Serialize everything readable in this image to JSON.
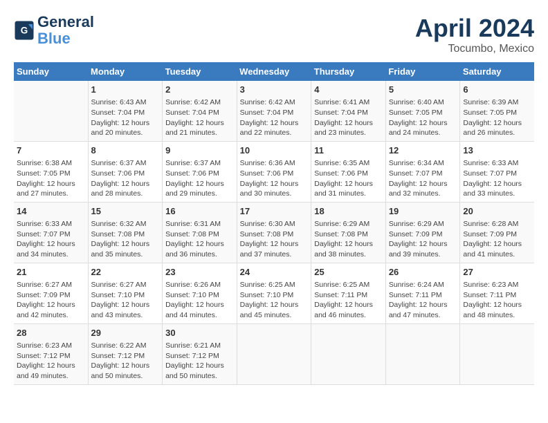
{
  "header": {
    "logo_line1": "General",
    "logo_line2": "Blue",
    "title": "April 2024",
    "subtitle": "Tocumbo, Mexico"
  },
  "days_of_week": [
    "Sunday",
    "Monday",
    "Tuesday",
    "Wednesday",
    "Thursday",
    "Friday",
    "Saturday"
  ],
  "weeks": [
    [
      {
        "day": "",
        "info": ""
      },
      {
        "day": "1",
        "info": "Sunrise: 6:43 AM\nSunset: 7:04 PM\nDaylight: 12 hours\nand 20 minutes."
      },
      {
        "day": "2",
        "info": "Sunrise: 6:42 AM\nSunset: 7:04 PM\nDaylight: 12 hours\nand 21 minutes."
      },
      {
        "day": "3",
        "info": "Sunrise: 6:42 AM\nSunset: 7:04 PM\nDaylight: 12 hours\nand 22 minutes."
      },
      {
        "day": "4",
        "info": "Sunrise: 6:41 AM\nSunset: 7:04 PM\nDaylight: 12 hours\nand 23 minutes."
      },
      {
        "day": "5",
        "info": "Sunrise: 6:40 AM\nSunset: 7:05 PM\nDaylight: 12 hours\nand 24 minutes."
      },
      {
        "day": "6",
        "info": "Sunrise: 6:39 AM\nSunset: 7:05 PM\nDaylight: 12 hours\nand 26 minutes."
      }
    ],
    [
      {
        "day": "7",
        "info": "Sunrise: 6:38 AM\nSunset: 7:05 PM\nDaylight: 12 hours\nand 27 minutes."
      },
      {
        "day": "8",
        "info": "Sunrise: 6:37 AM\nSunset: 7:06 PM\nDaylight: 12 hours\nand 28 minutes."
      },
      {
        "day": "9",
        "info": "Sunrise: 6:37 AM\nSunset: 7:06 PM\nDaylight: 12 hours\nand 29 minutes."
      },
      {
        "day": "10",
        "info": "Sunrise: 6:36 AM\nSunset: 7:06 PM\nDaylight: 12 hours\nand 30 minutes."
      },
      {
        "day": "11",
        "info": "Sunrise: 6:35 AM\nSunset: 7:06 PM\nDaylight: 12 hours\nand 31 minutes."
      },
      {
        "day": "12",
        "info": "Sunrise: 6:34 AM\nSunset: 7:07 PM\nDaylight: 12 hours\nand 32 minutes."
      },
      {
        "day": "13",
        "info": "Sunrise: 6:33 AM\nSunset: 7:07 PM\nDaylight: 12 hours\nand 33 minutes."
      }
    ],
    [
      {
        "day": "14",
        "info": "Sunrise: 6:33 AM\nSunset: 7:07 PM\nDaylight: 12 hours\nand 34 minutes."
      },
      {
        "day": "15",
        "info": "Sunrise: 6:32 AM\nSunset: 7:08 PM\nDaylight: 12 hours\nand 35 minutes."
      },
      {
        "day": "16",
        "info": "Sunrise: 6:31 AM\nSunset: 7:08 PM\nDaylight: 12 hours\nand 36 minutes."
      },
      {
        "day": "17",
        "info": "Sunrise: 6:30 AM\nSunset: 7:08 PM\nDaylight: 12 hours\nand 37 minutes."
      },
      {
        "day": "18",
        "info": "Sunrise: 6:29 AM\nSunset: 7:08 PM\nDaylight: 12 hours\nand 38 minutes."
      },
      {
        "day": "19",
        "info": "Sunrise: 6:29 AM\nSunset: 7:09 PM\nDaylight: 12 hours\nand 39 minutes."
      },
      {
        "day": "20",
        "info": "Sunrise: 6:28 AM\nSunset: 7:09 PM\nDaylight: 12 hours\nand 41 minutes."
      }
    ],
    [
      {
        "day": "21",
        "info": "Sunrise: 6:27 AM\nSunset: 7:09 PM\nDaylight: 12 hours\nand 42 minutes."
      },
      {
        "day": "22",
        "info": "Sunrise: 6:27 AM\nSunset: 7:10 PM\nDaylight: 12 hours\nand 43 minutes."
      },
      {
        "day": "23",
        "info": "Sunrise: 6:26 AM\nSunset: 7:10 PM\nDaylight: 12 hours\nand 44 minutes."
      },
      {
        "day": "24",
        "info": "Sunrise: 6:25 AM\nSunset: 7:10 PM\nDaylight: 12 hours\nand 45 minutes."
      },
      {
        "day": "25",
        "info": "Sunrise: 6:25 AM\nSunset: 7:11 PM\nDaylight: 12 hours\nand 46 minutes."
      },
      {
        "day": "26",
        "info": "Sunrise: 6:24 AM\nSunset: 7:11 PM\nDaylight: 12 hours\nand 47 minutes."
      },
      {
        "day": "27",
        "info": "Sunrise: 6:23 AM\nSunset: 7:11 PM\nDaylight: 12 hours\nand 48 minutes."
      }
    ],
    [
      {
        "day": "28",
        "info": "Sunrise: 6:23 AM\nSunset: 7:12 PM\nDaylight: 12 hours\nand 49 minutes."
      },
      {
        "day": "29",
        "info": "Sunrise: 6:22 AM\nSunset: 7:12 PM\nDaylight: 12 hours\nand 50 minutes."
      },
      {
        "day": "30",
        "info": "Sunrise: 6:21 AM\nSunset: 7:12 PM\nDaylight: 12 hours\nand 50 minutes."
      },
      {
        "day": "",
        "info": ""
      },
      {
        "day": "",
        "info": ""
      },
      {
        "day": "",
        "info": ""
      },
      {
        "day": "",
        "info": ""
      }
    ]
  ]
}
